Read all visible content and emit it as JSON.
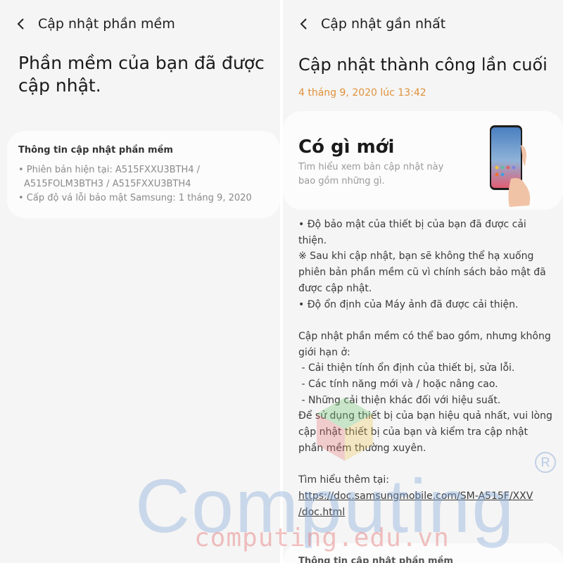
{
  "left_screen": {
    "header_title": "Cập nhật phần mềm",
    "message": "Phần mềm của bạn đã được cập nhật.",
    "info_card": {
      "heading": "Thông tin cập nhật phần mềm",
      "line1": "• Phiên bản hiện tại: A515FXXU3BTH4 /",
      "line2": "A515FOLM3BTH3 / A515FXXU3BTH4",
      "line3": "• Cấp độ vá lỗi bảo mật Samsung: 1 tháng 9, 2020"
    }
  },
  "right_screen": {
    "header_title": "Cập nhật gần nhất",
    "title": "Cập nhật thành công lần cuối",
    "date": "4 tháng 9, 2020 lúc 13:42",
    "whats_new_card": {
      "heading": "Có gì mới",
      "subtitle": "Tìm hiểu xem bản cập nhật này bao gồm những gì."
    },
    "body_text": "• Độ bảo mật của thiết bị của bạn đã được cải thiện.\n※ Sau khi cập nhật, bạn sẽ không thể hạ xuống phiên bản phần mềm cũ vì chính sách bảo mật đã được cập nhật.\n• Độ ổn định của Máy ảnh đã được cải thiện.\n\nCập nhật phần mềm có thể bao gồm, nhưng không giới hạn ở:\n - Cải thiện tính ổn định của thiết bị, sửa lỗi.\n - Các tính năng mới và / hoặc nâng cao.\n - Những cải thiện khác đối với hiệu suất.\nĐể sử dụng thiết bị của bạn hiệu quả nhất, vui lòng cập nhật thiết bị của bạn và kiểm tra cập nhật phần mềm thường xuyên.\n\nTìm hiểu thêm tại:",
    "link_line1": "https://doc.samsungmobile.com/SM-A515F/XXV",
    "link_line2": "/doc.html",
    "bottom_card_heading": "Thông tin cập nhật phần mềm"
  },
  "watermark": {
    "main": "Computing",
    "sub": "computing.edu.vn",
    "reg": "R"
  },
  "colors": {
    "background": "#f5f5f5",
    "card": "#fcfcfc",
    "date_accent": "#e0913a",
    "secondary_text": "#8a8a8a"
  },
  "icons": [
    "back-arrow-icon",
    "phone-illustration-icon"
  ]
}
